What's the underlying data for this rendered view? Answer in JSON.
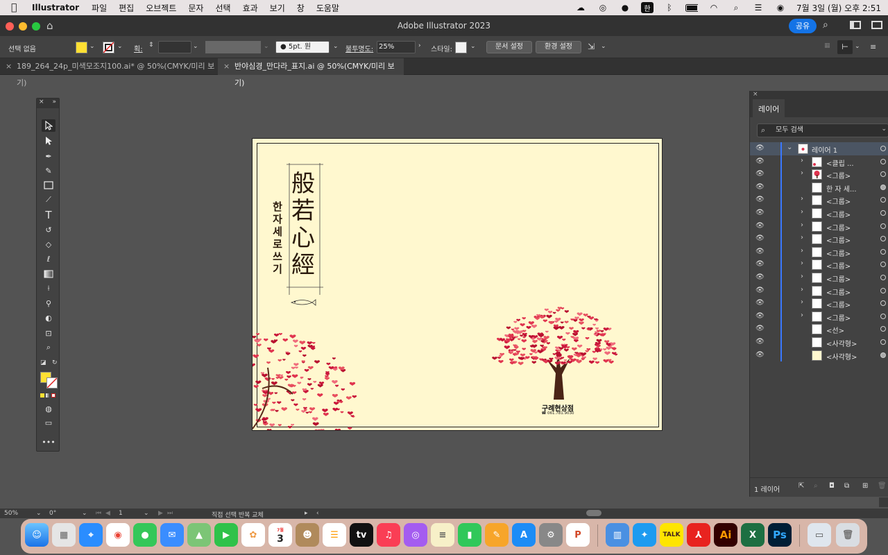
{
  "menubar": {
    "app": "Illustrator",
    "items": [
      "파일",
      "편집",
      "오브젝트",
      "문자",
      "선택",
      "효과",
      "보기",
      "창",
      "도움말"
    ],
    "ime": "한",
    "clock": "7월 3일 (월) 오후 2:51"
  },
  "window": {
    "title": "Adobe Illustrator 2023",
    "share": "공유"
  },
  "controlbar": {
    "selection": "선택 없음",
    "stroke_label": "획:",
    "brush": "5pt. 원",
    "opacity_label": "불투명도:",
    "opacity_value": "25%",
    "style_label": "스타일:",
    "doc_setup": "문서 설정",
    "prefs": "환경 설정",
    "fill_color": "#ffe033"
  },
  "tabs": [
    {
      "label": "189_264_24p_미색모조지100.ai* @ 50%(CMYK/미리 보기)"
    },
    {
      "label": "반야심경_만다라_표지.ai @ 50%(CMYK/미리 보기)"
    }
  ],
  "artwork": {
    "title_chars": [
      "般",
      "若",
      "心",
      "經"
    ],
    "subtitle_chars": [
      "한",
      "자",
      "세",
      "로",
      "쓰",
      "기"
    ],
    "shop_name": "구례현상점",
    "phone": "☎ 061.781.9030",
    "paper_color": "#fff8cf",
    "blossom_color": "#e0344f"
  },
  "layers": {
    "tab": "레이어",
    "search_placeholder": "모두 검색",
    "rows": [
      {
        "name": "레이어 1"
      },
      {
        "name": "<클립 ..."
      },
      {
        "name": "<그룹>"
      },
      {
        "name": "한 자 세..."
      },
      {
        "name": "<그룹>"
      },
      {
        "name": "<그룹>"
      },
      {
        "name": "<그룹>"
      },
      {
        "name": "<그룹>"
      },
      {
        "name": "<그룹>"
      },
      {
        "name": "<그룹>"
      },
      {
        "name": "<그룹>"
      },
      {
        "name": "<그룹>"
      },
      {
        "name": "<그룹>"
      },
      {
        "name": "<그룹>"
      },
      {
        "name": "<선>"
      },
      {
        "name": "<사각형>"
      },
      {
        "name": "<사각형>"
      }
    ],
    "footer": "1 레이어"
  },
  "status": {
    "zoom": "50%",
    "rotation": "0°",
    "artboard": "1",
    "tool_hint": "직접 선택 반복 교체"
  },
  "dock": {
    "calendar_month": "7월",
    "calendar_day": "3",
    "kakao": "TALK",
    "ai": "Ai",
    "ps": "Ps"
  }
}
